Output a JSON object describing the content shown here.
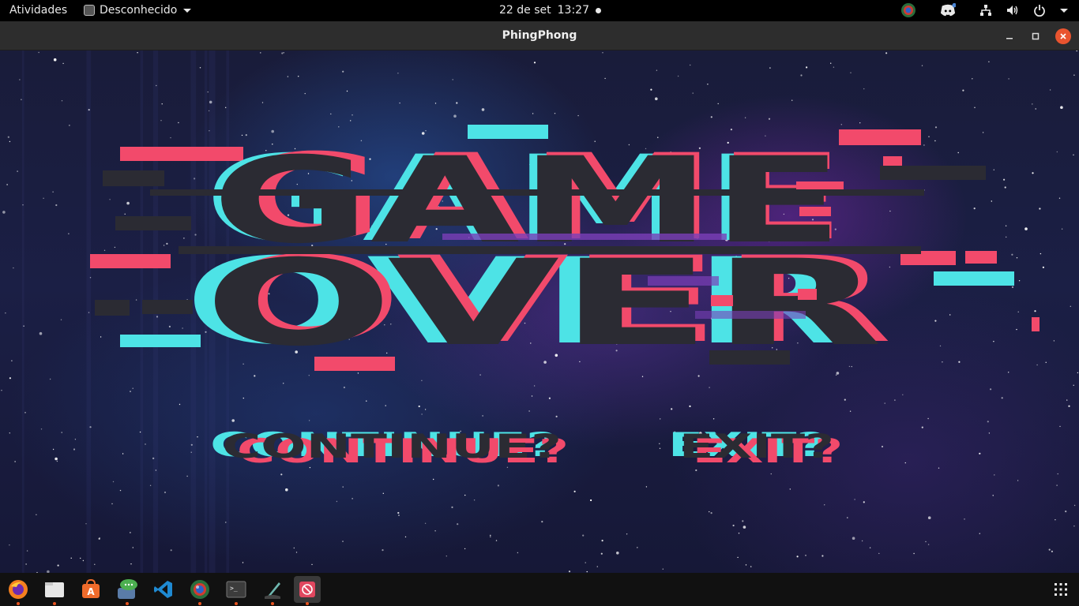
{
  "topbar": {
    "activities": "Atividades",
    "app_menu": "Desconhecido",
    "date": "22 de set",
    "time": "13:27"
  },
  "window": {
    "title": "PhingPhong"
  },
  "game": {
    "headline_line1": "GAME",
    "headline_line2": "OVER",
    "continue_label": "CONTINUE?",
    "exit_label": "EXIT?",
    "colors": {
      "pink": "#f24a6b",
      "cyan": "#4de3e6",
      "dark": "#2b2b33"
    }
  },
  "dock": {
    "apps": [
      "firefox-icon",
      "files-icon",
      "software-center-icon",
      "messaging-icon",
      "vscode-icon",
      "colored-orb-icon",
      "terminal-icon",
      "inkscape-icon",
      "phingphong-icon"
    ],
    "show_apps": "show-applications-icon"
  }
}
